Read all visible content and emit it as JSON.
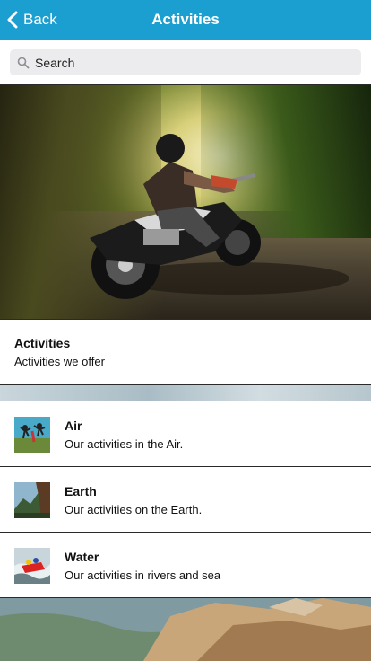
{
  "navbar": {
    "back_label": "Back",
    "title": "Activities",
    "background_color": "#1a9fd0"
  },
  "search": {
    "placeholder": "Search",
    "icon": "search-icon"
  },
  "hero": {
    "image": "motorcycle-rider-photo"
  },
  "info": {
    "title": "Activities",
    "subtitle": "Activities we offer"
  },
  "items": [
    {
      "title": "Air",
      "subtitle": "Our activities in the Air.",
      "thumb": "skydivers-photo"
    },
    {
      "title": "Earth",
      "subtitle": "Our activities on the Earth.",
      "thumb": "cliff-climbing-photo"
    },
    {
      "title": "Water",
      "subtitle": "Our activities in rivers and sea",
      "thumb": "rafting-photo"
    }
  ],
  "bottom_image": "rocky-coast-photo"
}
